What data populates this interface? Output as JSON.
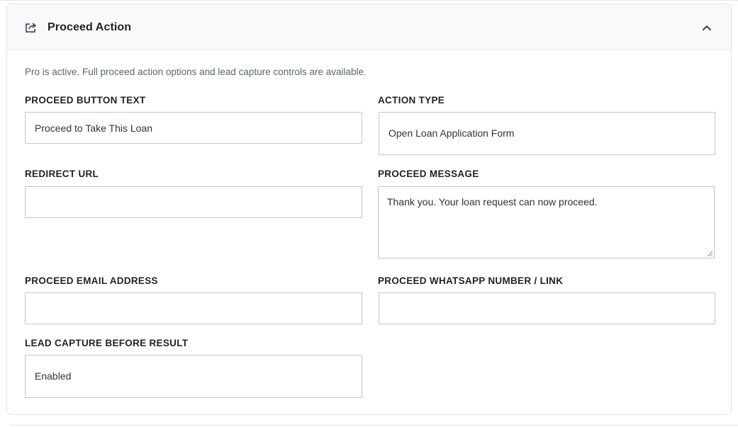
{
  "header": {
    "icon": "share-export-icon",
    "title": "Proceed Action",
    "toggle_icon": "chevron-up-icon"
  },
  "notice": "Pro is active. Full proceed action options and lead capture controls are available.",
  "fields": {
    "proceed_button_text": {
      "label": "PROCEED BUTTON TEXT",
      "value": "Proceed to Take This Loan"
    },
    "action_type": {
      "label": "ACTION TYPE",
      "value": "Open Loan Application Form"
    },
    "redirect_url": {
      "label": "REDIRECT URL",
      "value": ""
    },
    "proceed_message": {
      "label": "PROCEED MESSAGE",
      "value": "Thank you. Your loan request can now proceed."
    },
    "proceed_email": {
      "label": "PROCEED EMAIL ADDRESS",
      "value": ""
    },
    "proceed_whatsapp": {
      "label": "PROCEED WHATSAPP NUMBER / LINK",
      "value": ""
    },
    "lead_capture": {
      "label": "LEAD CAPTURE BEFORE RESULT",
      "value": "Enabled"
    }
  },
  "colors": {
    "header_bg": "#f8f9fb",
    "border": "#c3c7cc",
    "label": "#1d2327",
    "notice": "#5b6570"
  }
}
